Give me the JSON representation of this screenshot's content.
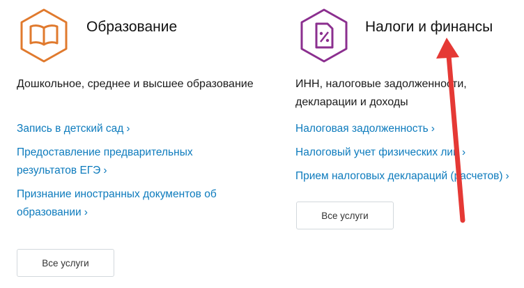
{
  "cards": [
    {
      "title": "Образование",
      "icon": "book-icon",
      "accent": "#e07a2e",
      "description": "Дошкольное, среднее и высшее образование",
      "links": [
        {
          "label": "Запись в детский сад"
        },
        {
          "label": "Предоставление предварительных результатов ЕГЭ"
        },
        {
          "label": "Признание иностранных документов об образовании"
        }
      ],
      "button": "Все услуги"
    },
    {
      "title": "Налоги и финансы",
      "icon": "tax-document-icon",
      "accent": "#8b2f8f",
      "description": "ИНН, налоговые задолженности, декларации и доходы",
      "links": [
        {
          "label": "Налоговая задолженность"
        },
        {
          "label": "Налоговый учет физических лиц"
        },
        {
          "label": "Прием налоговых деклараций (расчетов)"
        }
      ],
      "button": "Все услуги"
    }
  ],
  "link_chevron": "›",
  "colors": {
    "link": "#0d7bbd",
    "annotation_arrow": "#e53935"
  }
}
